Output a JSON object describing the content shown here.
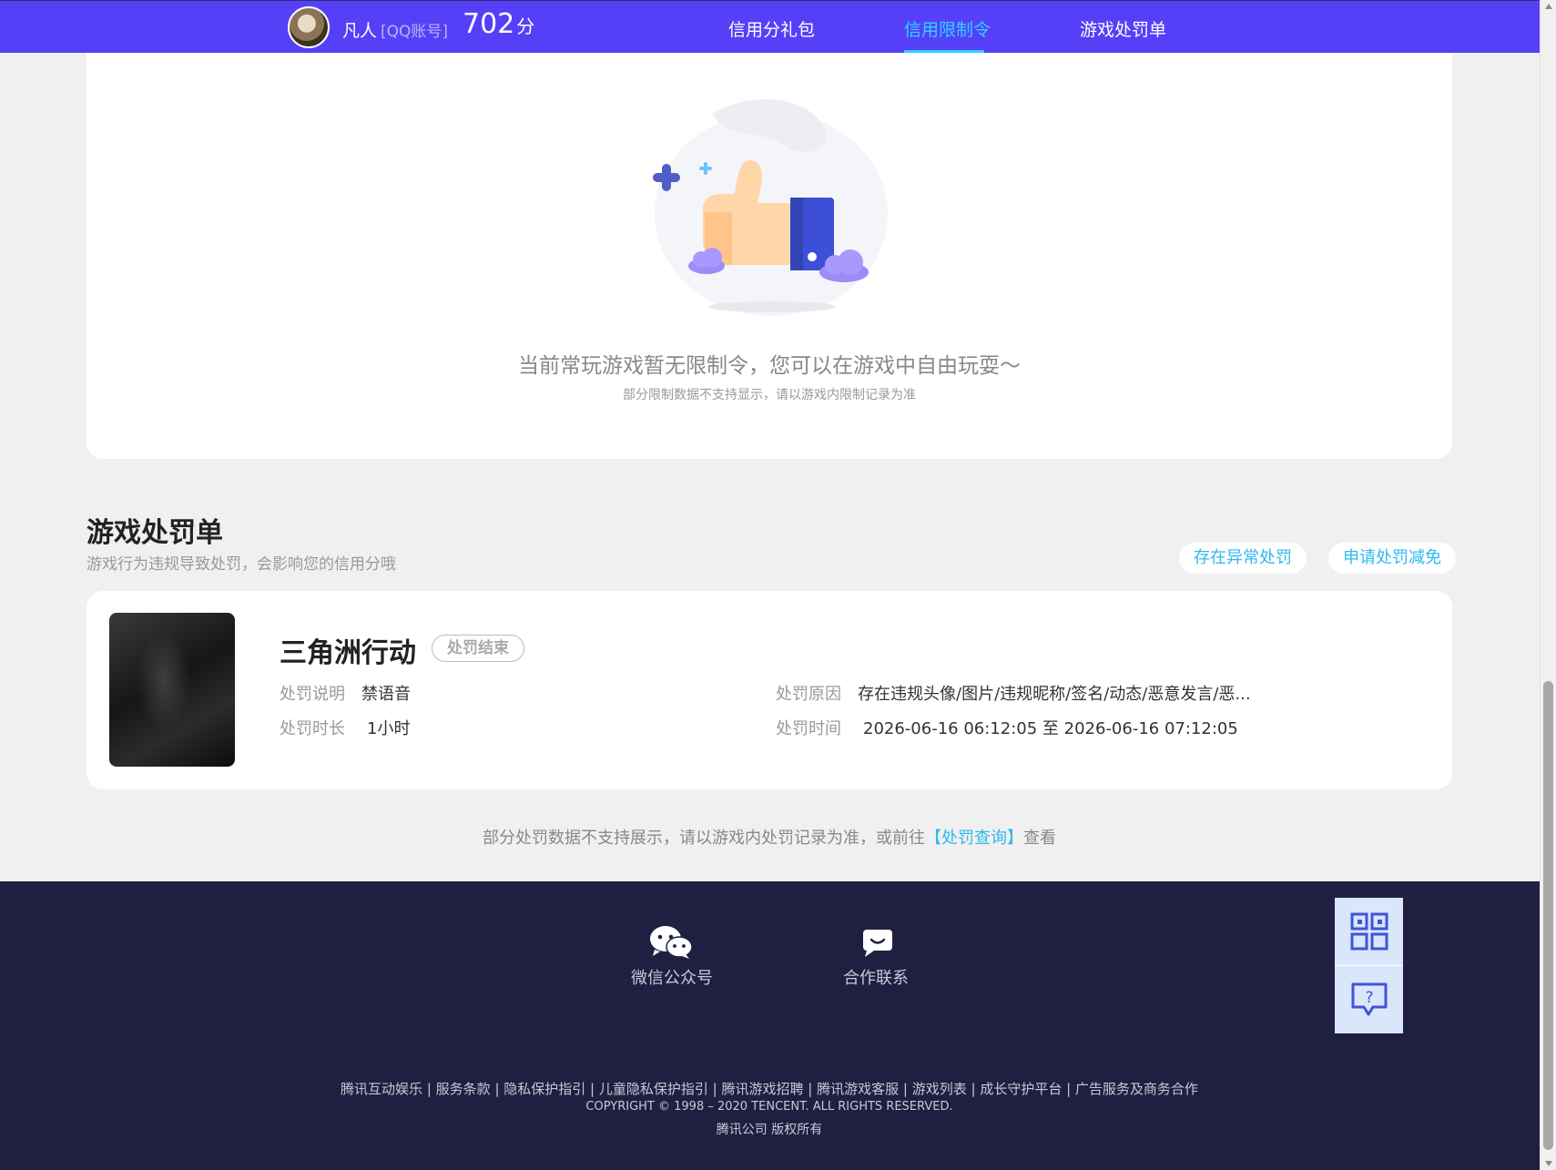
{
  "header": {
    "user_name": "凡人",
    "account_tag": "[QQ账号]",
    "score": "702",
    "score_unit": "分",
    "nav": [
      "信用分礼包",
      "信用限制令",
      "游戏处罚单"
    ],
    "active_nav": "信用限制令"
  },
  "restriction": {
    "empty_title": "当前常玩游戏暂无限制令，您可以在游戏中自由玩耍～",
    "empty_sub": "部分限制数据不支持显示，请以游戏内限制记录为准"
  },
  "penalty": {
    "title": "游戏处罚单",
    "subtitle": "游戏行为违规导致处罚，会影响您的信用分哦",
    "btn_abnormal": "存在异常处罚",
    "btn_appeal": "申请处罚减免",
    "item": {
      "game": "三角洲行动",
      "status": "处罚结束",
      "desc_label": "处罚说明",
      "desc_value": "禁语音",
      "duration_label": "处罚时长",
      "duration_value": "1小时",
      "reason_label": "处罚原因",
      "reason_value": "存在违规头像/图片/违规昵称/签名/动态/恶意发言/恶...",
      "time_label": "处罚时间",
      "time_value": "2026-06-16 06:12:05 至 2026-06-16 07:12:05"
    },
    "note_prefix": "部分处罚数据不支持展示，请以游戏内处罚记录为准，或前往",
    "note_link": "【处罚查询】",
    "note_suffix": "查看"
  },
  "footer": {
    "wechat_label": "微信公众号",
    "contact_label": "合作联系",
    "links": [
      "腾讯互动娱乐",
      "服务条款",
      "隐私保护指引",
      "儿童隐私保护指引",
      "腾讯游戏招聘",
      "腾讯游戏客服",
      "游戏列表",
      "成长守护平台",
      "广告服务及商务合作"
    ],
    "copyright": "COPYRIGHT © 1998 – 2020 TENCENT. ALL RIGHTS RESERVED.",
    "rights": "腾讯公司 版权所有"
  },
  "icons": {
    "wechat": "wechat-icon",
    "contact": "chat-bubble-icon",
    "qrcode": "qrcode-icon",
    "help": "help-icon"
  },
  "colors": {
    "header_bg": "#5540f8",
    "accent": "#2fd3ff",
    "link": "#2fb8f0",
    "footer_bg": "#1f2041"
  }
}
